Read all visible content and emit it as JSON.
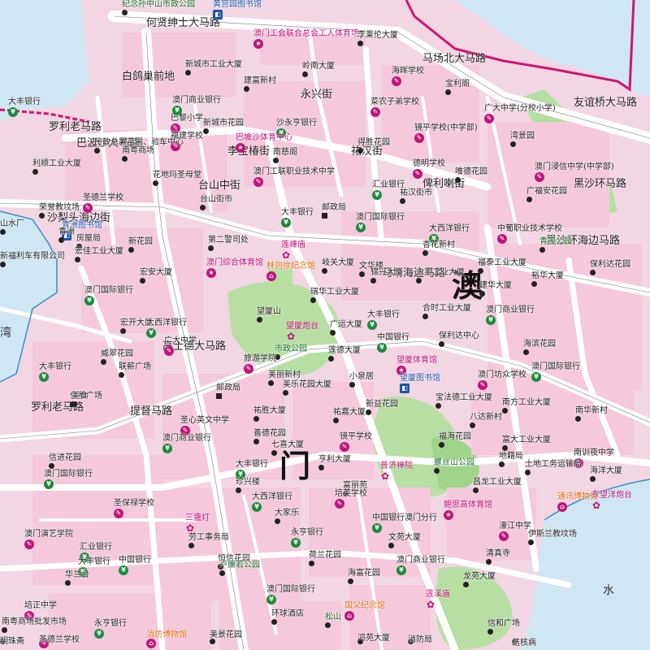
{
  "map_title": "",
  "region_label": "澳",
  "region_label2": "门",
  "sea_labels": [
    "湾",
    "水"
  ],
  "street_labels": [
    "白鸽巢前地",
    "罗利老马路",
    "巴波沙大马路",
    "李宝椿街",
    "台山中街",
    "沙梨头海边街",
    "提督马路",
    "高士德大马路",
    "罗利老马路",
    "永兴街",
    "马场北大马路",
    "友谊桥大马路",
    "黑沙环马路",
    "何贤绅士大马路",
    "祐汉街",
    "黑沙环海边马路",
    "马场海边马路",
    "俾利喇街"
  ],
  "places": [
    {
      "name": "纪念孙中山市政公园",
      "kind": "park"
    },
    {
      "name": "黄宫园图书馆",
      "kind": "library"
    },
    {
      "name": "澳门工会联合总会工人体育场",
      "kind": "stadium"
    },
    {
      "name": "李乘伦大厦",
      "kind": "building"
    },
    {
      "name": "海晖学校",
      "kind": "school"
    },
    {
      "name": "宝利阁",
      "kind": "building"
    },
    {
      "name": "菜农子弟学校",
      "kind": "school"
    },
    {
      "name": "广大中学(分校小学)",
      "kind": "school"
    },
    {
      "name": "湾景园",
      "kind": "building"
    },
    {
      "name": "镜平学校(中学部)",
      "kind": "school"
    },
    {
      "name": "得胜花园",
      "kind": "building"
    },
    {
      "name": "德明学校",
      "kind": "school"
    },
    {
      "name": "唯德花园",
      "kind": "building"
    },
    {
      "name": "澳门浸信中学(中学部)",
      "kind": "school"
    },
    {
      "name": "广福安花园",
      "kind": "building"
    },
    {
      "name": "青茂公园",
      "kind": "park"
    },
    {
      "name": "新城市工业大厦",
      "kind": "building"
    },
    {
      "name": "建富新村",
      "kind": "building"
    },
    {
      "name": "岭南大厦",
      "kind": "building"
    },
    {
      "name": "巴黎小学",
      "kind": "school"
    },
    {
      "name": "澳门商业银行",
      "kind": "bank"
    },
    {
      "name": "新城市花园",
      "kind": "building"
    },
    {
      "name": "沙永亨银行",
      "kind": "bank"
    },
    {
      "name": "南粤商场",
      "kind": "building"
    },
    {
      "name": "巴坡沙体育中心",
      "kind": "stadium"
    },
    {
      "name": "南慈阁",
      "kind": "building"
    },
    {
      "name": "福建学校",
      "kind": "school"
    },
    {
      "name": "民政总署苗圃、验车中心",
      "kind": "building"
    },
    {
      "name": "利顺工业大厦",
      "kind": "building"
    },
    {
      "name": "花地玛圣母堂",
      "kind": "church"
    },
    {
      "name": "澳门工联职业技术中学",
      "kind": "school"
    },
    {
      "name": "汇业银行",
      "kind": "bank"
    },
    {
      "name": "圣德兰学校",
      "kind": "school"
    },
    {
      "name": "台山街市",
      "kind": "market"
    },
    {
      "name": "大丰银行",
      "kind": "bank"
    },
    {
      "name": "邮政局",
      "kind": "post"
    },
    {
      "name": "澳门国际银行",
      "kind": "bank"
    },
    {
      "name": "祐汉街市",
      "kind": "market"
    },
    {
      "name": "大西洋银行",
      "kind": "bank"
    },
    {
      "name": "中葡职业技术学校",
      "kind": "school"
    },
    {
      "name": "杏花新村",
      "kind": "building"
    },
    {
      "name": "青洲图书馆",
      "kind": "library"
    },
    {
      "name": "第二警司处",
      "kind": "police"
    },
    {
      "name": "莲峰庙",
      "kind": "temple"
    },
    {
      "name": "房屋局",
      "kind": "building"
    },
    {
      "name": "宏佳工业大厦",
      "kind": "building"
    },
    {
      "name": "新花园",
      "kind": "building"
    },
    {
      "name": "福泰工业大厦",
      "kind": "building"
    },
    {
      "name": "保利达花园",
      "kind": "building"
    },
    {
      "name": "澳门综合体育馆",
      "kind": "stadium"
    },
    {
      "name": "林则徐纪念馆",
      "kind": "museum"
    },
    {
      "name": "岐关大厦",
      "kind": "building"
    },
    {
      "name": "文华楼",
      "kind": "building"
    },
    {
      "name": "锦兴大厦",
      "kind": "building"
    },
    {
      "name": "永丰工业大厦",
      "kind": "building"
    },
    {
      "name": "建华大厦",
      "kind": "building"
    },
    {
      "name": "裕华大厦",
      "kind": "building"
    },
    {
      "name": "宏安大厦",
      "kind": "building"
    },
    {
      "name": "澳门国际银行",
      "kind": "bank"
    },
    {
      "name": "瑞华工业大厦",
      "kind": "building"
    },
    {
      "name": "合时工业大厦",
      "kind": "building"
    },
    {
      "name": "澳门商业银行",
      "kind": "bank"
    },
    {
      "name": "宏开大厦",
      "kind": "building"
    },
    {
      "name": "大西洋银行",
      "kind": "bank"
    },
    {
      "name": "广大中学",
      "kind": "school"
    },
    {
      "name": "望厦山",
      "kind": "mountain"
    },
    {
      "name": "望厦炮台",
      "kind": "fort"
    },
    {
      "name": "广运大厦",
      "kind": "building"
    },
    {
      "name": "大丰银行",
      "kind": "bank"
    },
    {
      "name": "中国银行",
      "kind": "bank"
    },
    {
      "name": "保利达中心",
      "kind": "building"
    },
    {
      "name": "海滨花园",
      "kind": "building"
    },
    {
      "name": "威翠花园",
      "kind": "building"
    },
    {
      "name": "市政公园",
      "kind": "park"
    },
    {
      "name": "莲德大厦",
      "kind": "building"
    },
    {
      "name": "望厦体育馆",
      "kind": "stadium"
    },
    {
      "name": "大丰银行",
      "kind": "bank"
    },
    {
      "name": "联薪广场",
      "kind": "building"
    },
    {
      "name": "旅游学院",
      "kind": "school"
    },
    {
      "name": "美丽新村",
      "kind": "building"
    },
    {
      "name": "小泉居",
      "kind": "building"
    },
    {
      "name": "望厦图书馆",
      "kind": "library"
    },
    {
      "name": "澳门坊众学校",
      "kind": "school"
    },
    {
      "name": "澳门国际银行",
      "kind": "bank"
    },
    {
      "name": "信和广场",
      "kind": "building"
    },
    {
      "name": "美乐花园大厦",
      "kind": "building"
    },
    {
      "name": "新益花园",
      "kind": "building"
    },
    {
      "name": "宝法德工业大厦",
      "kind": "building"
    },
    {
      "name": "南方工业大厦",
      "kind": "building"
    },
    {
      "name": "南华新村",
      "kind": "building"
    },
    {
      "name": "邮政局",
      "kind": "post"
    },
    {
      "name": "祐嘉大厦",
      "kind": "building"
    },
    {
      "name": "八达新村",
      "kind": "building"
    },
    {
      "name": "圣心英文中学",
      "kind": "school"
    },
    {
      "name": "祐胜大厦",
      "kind": "building"
    },
    {
      "name": "善德花园",
      "kind": "building"
    },
    {
      "name": "福海花园",
      "kind": "building"
    },
    {
      "name": "富大工业大厦",
      "kind": "building"
    },
    {
      "name": "南训夜中学",
      "kind": "school"
    },
    {
      "name": "地籍局",
      "kind": "building"
    },
    {
      "name": "澳门商业银行",
      "kind": "bank"
    },
    {
      "name": "七喜大厦",
      "kind": "building"
    },
    {
      "name": "镜平学校",
      "kind": "school"
    },
    {
      "name": "普济禅院",
      "kind": "temple"
    },
    {
      "name": "信进花园",
      "kind": "building"
    },
    {
      "name": "澳门国际银行",
      "kind": "bank"
    },
    {
      "name": "亨利大厦",
      "kind": "building"
    },
    {
      "name": "螺丝山公园",
      "kind": "park"
    },
    {
      "name": "昌龙工业大厦",
      "kind": "building"
    },
    {
      "name": "土地工务运输局",
      "kind": "building"
    },
    {
      "name": "海洋大厦",
      "kind": "building"
    },
    {
      "name": "大丰银行",
      "kind": "bank"
    },
    {
      "name": "珍兴楼",
      "kind": "building"
    },
    {
      "name": "富丽苑",
      "kind": "building"
    },
    {
      "name": "通讯博物馆",
      "kind": "museum"
    },
    {
      "name": "东望洋炮台",
      "kind": "fort"
    },
    {
      "name": "圣保禄学校",
      "kind": "school"
    },
    {
      "name": "大西洋银行",
      "kind": "bank"
    },
    {
      "name": "培英学校",
      "kind": "school"
    },
    {
      "name": "大家乐",
      "kind": "building"
    },
    {
      "name": "中国银行澳门分行",
      "kind": "bank"
    },
    {
      "name": "鲍思高体育馆",
      "kind": "stadium"
    },
    {
      "name": "濠江中学",
      "kind": "school"
    },
    {
      "name": "伊斯兰教坟场",
      "kind": "building"
    },
    {
      "name": "三盏灯",
      "kind": "landmark"
    },
    {
      "name": "劳工事务局",
      "kind": "building"
    },
    {
      "name": "永亨银行",
      "kind": "bank"
    },
    {
      "name": "文苑大厦",
      "kind": "building"
    },
    {
      "name": "清真寺",
      "kind": "building"
    },
    {
      "name": "荷兰花园",
      "kind": "building"
    },
    {
      "name": "澳门商业银行",
      "kind": "bank"
    },
    {
      "name": "汇业银行",
      "kind": "bank"
    },
    {
      "name": "大丰银行",
      "kind": "bank"
    },
    {
      "name": "中国银行",
      "kind": "bank"
    },
    {
      "name": "恒信花园",
      "kind": "building"
    },
    {
      "name": "澳门演艺学院",
      "kind": "school"
    },
    {
      "name": "海富花园",
      "kind": "building"
    },
    {
      "name": "龙苑大厦",
      "kind": "building"
    },
    {
      "name": "莲溪庙",
      "kind": "temple"
    },
    {
      "name": "华兰台",
      "kind": "building"
    },
    {
      "name": "培正中学",
      "kind": "school"
    },
    {
      "name": "澳门国际银行",
      "kind": "bank"
    },
    {
      "name": "卢廉若公园",
      "kind": "park"
    },
    {
      "name": "环球酒店",
      "kind": "hotel"
    },
    {
      "name": "国父纪念馆",
      "kind": "museum"
    },
    {
      "name": "松山",
      "kind": "park"
    },
    {
      "name": "消防局",
      "kind": "building"
    },
    {
      "name": "消防博物馆",
      "kind": "museum"
    },
    {
      "name": "永亨银行",
      "kind": "bank"
    },
    {
      "name": "圣德兰学校",
      "kind": "school"
    },
    {
      "name": "南粤商场批发市场",
      "kind": "building"
    },
    {
      "name": "大丰银行",
      "kind": "bank"
    },
    {
      "name": "青洲",
      "kind": "area"
    },
    {
      "name": "新福利车有限公司",
      "kind": "building"
    },
    {
      "name": "山水厂",
      "kind": "building"
    },
    {
      "name": "美景花园",
      "kind": "building"
    },
    {
      "name": "鸿苑大厦",
      "kind": "building"
    },
    {
      "name": "结核病",
      "kind": "building"
    },
    {
      "name": "美食",
      "kind": "building"
    },
    {
      "name": "信和广场",
      "kind": "building"
    },
    {
      "name": "明珠斋",
      "kind": "building"
    },
    {
      "name": "荣誉教坟场",
      "kind": "building"
    }
  ],
  "colors": {
    "land": "#f2d6e4",
    "block": "#f5c8dc",
    "road": "#ffffff",
    "main_road": "#ffffff",
    "water": "#cfe7f2",
    "park": "#b7dfa3",
    "border": "#d01470"
  }
}
